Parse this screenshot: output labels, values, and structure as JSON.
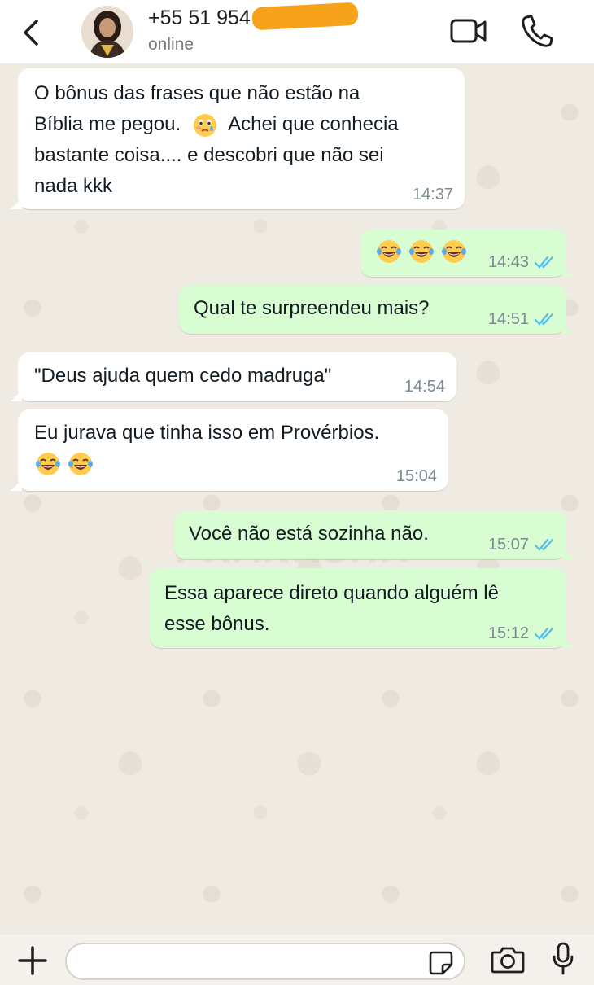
{
  "header": {
    "contact_name": "+55 51 954",
    "contact_status": "online"
  },
  "messages": [
    {
      "direction": "in",
      "text_lines": [
        "O bônus das frases que não estão na",
        "Bíblia me pegou.",
        "Achei que conhecia",
        "bastante coisa.... e descobri que não sei",
        "nada kkk"
      ],
      "time": "14:37"
    },
    {
      "direction": "out",
      "emoji": [
        "face-with-tears-of-joy",
        "face-with-tears-of-joy",
        "face-with-tears-of-joy"
      ],
      "time": "14:43",
      "read": true
    },
    {
      "direction": "out",
      "text": "Qual te surpreendeu mais?",
      "time": "14:51",
      "read": true
    },
    {
      "direction": "in",
      "text": "\"Deus ajuda quem cedo madruga\"",
      "time": "14:54"
    },
    {
      "direction": "in",
      "text": "Eu jurava que tinha isso em Provérbios.",
      "emoji": [
        "face-with-tears-of-joy",
        "face-with-tears-of-joy"
      ],
      "time": "15:04"
    },
    {
      "direction": "out",
      "text": "Você não está sozinha não.",
      "time": "15:07",
      "read": true
    },
    {
      "direction": "out",
      "text_lines": [
        "Essa aparece direto quando alguém lê",
        "esse bônus."
      ],
      "time": "15:12",
      "read": true
    }
  ],
  "watermark": "PRANKSHIT",
  "composer": {
    "placeholder": ""
  },
  "icons": {
    "back": "chevron-left-icon",
    "video": "video-camera-icon",
    "call": "phone-icon",
    "attach": "plus-icon",
    "sticker": "sticker-icon",
    "camera": "camera-icon",
    "mic": "microphone-icon",
    "read_receipt": "double-check-icon",
    "disappointed_emoji": "face-holding-back-tears-icon"
  },
  "colors": {
    "outgoing_bubble": "#d9fdd3",
    "incoming_bubble": "#ffffff",
    "chat_background": "#efeae2",
    "read_ticks": "#53bdeb",
    "timestamp": "#7d8a92"
  }
}
